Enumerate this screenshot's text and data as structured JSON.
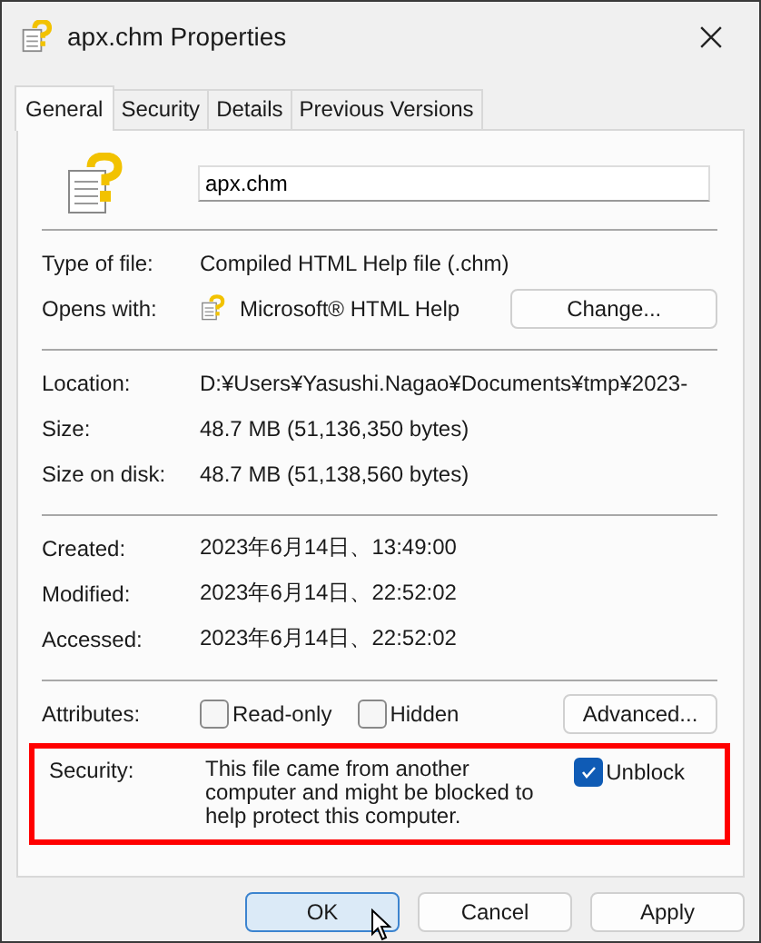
{
  "window": {
    "title": "apx.chm Properties"
  },
  "tabs": [
    {
      "label": "General",
      "selected": true
    },
    {
      "label": "Security",
      "selected": false
    },
    {
      "label": "Details",
      "selected": false
    },
    {
      "label": "Previous Versions",
      "selected": false
    }
  ],
  "file_name": "apx.chm",
  "sections": [
    {
      "rows": [
        {
          "kind": "text",
          "label": "Type of file:",
          "value": "Compiled HTML Help file (.chm)"
        },
        {
          "kind": "app",
          "label": "Opens with:",
          "value": "Microsoft® HTML Help",
          "button": "Change..."
        }
      ]
    },
    {
      "rows": [
        {
          "kind": "text",
          "label": "Location:",
          "value": "D:¥Users¥Yasushi.Nagao¥Documents¥tmp¥2023-"
        },
        {
          "kind": "text",
          "label": "Size:",
          "value": "48.7 MB (51,136,350 bytes)"
        },
        {
          "kind": "text",
          "label": "Size on disk:",
          "value": "48.7 MB (51,138,560 bytes)"
        }
      ]
    },
    {
      "rows": [
        {
          "kind": "text",
          "label": "Created:",
          "value": "2023年6月14日、13:49:00"
        },
        {
          "kind": "text",
          "label": "Modified:",
          "value": "2023年6月14日、22:52:02"
        },
        {
          "kind": "text",
          "label": "Accessed:",
          "value": "2023年6月14日、22:52:02"
        }
      ]
    },
    {
      "rows": [
        {
          "kind": "attributes",
          "label": "Attributes:",
          "checkboxes": [
            {
              "label": "Read-only",
              "checked": false
            },
            {
              "label": "Hidden",
              "checked": false
            }
          ],
          "button": "Advanced..."
        },
        {
          "kind": "security",
          "label": "Security:",
          "highlighted": true,
          "message": "This file came from another computer and might be blocked to help protect this computer.",
          "checkbox": {
            "label": "Unblock",
            "checked": true
          }
        }
      ]
    }
  ],
  "buttons": [
    {
      "label": "OK",
      "default": true
    },
    {
      "label": "Cancel",
      "default": false
    },
    {
      "label": "Apply",
      "default": false
    }
  ]
}
